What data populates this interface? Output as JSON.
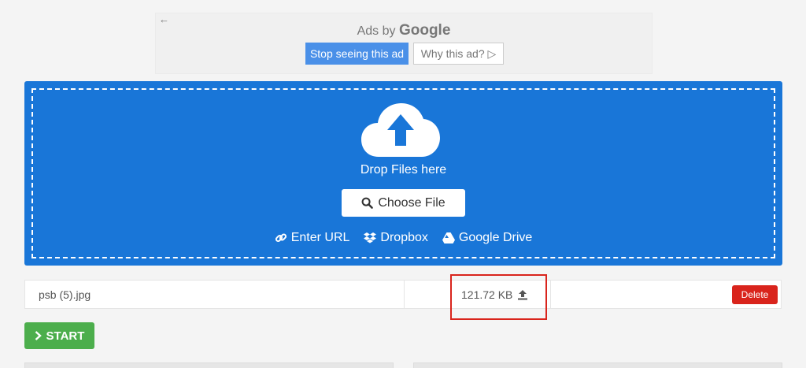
{
  "ad": {
    "back_icon": "arrow-left-icon",
    "ads_by": "Ads by",
    "google": "Google",
    "stop_label": "Stop seeing this ad",
    "why_label": "Why this ad?",
    "why_icon": "adchoices-icon"
  },
  "upload": {
    "cloud_icon": "cloud-upload-icon",
    "drop_text": "Drop Files here",
    "choose_label": "Choose File",
    "sources": [
      {
        "label": "Enter URL",
        "icon": "link-icon"
      },
      {
        "label": "Dropbox",
        "icon": "dropbox-icon"
      },
      {
        "label": "Google Drive",
        "icon": "google-drive-icon"
      }
    ]
  },
  "file": {
    "name": "psb (5).jpg",
    "size": "121.72 KB",
    "delete_label": "Delete"
  },
  "start_label": "START",
  "colors": {
    "primary": "#1976d8",
    "success": "#4cae4c",
    "danger": "#d9241c",
    "ad_blue": "#4a90e8"
  }
}
